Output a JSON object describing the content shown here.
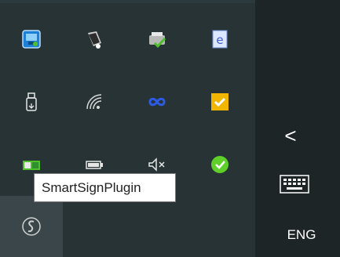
{
  "tooltip": {
    "text": "SmartSignPlugin"
  },
  "taskbar": {
    "language": "ENG",
    "chevron": "<"
  },
  "tray_icons": [
    {
      "name": "network-config-icon"
    },
    {
      "name": "speaker-app-icon"
    },
    {
      "name": "printer-check-icon"
    },
    {
      "name": "e-app-icon"
    },
    {
      "name": "usb-drive-icon"
    },
    {
      "name": "wifi-icon"
    },
    {
      "name": "infinity-link-icon"
    },
    {
      "name": "security-check-icon"
    },
    {
      "name": "battery-plug-icon"
    },
    {
      "name": "battery-icon"
    },
    {
      "name": "volume-icon"
    },
    {
      "name": "green-shield-icon"
    },
    {
      "name": "smartsign-plugin-icon"
    }
  ],
  "colors": {
    "flyout_bg": "#283335",
    "taskbar_bg": "#1e2527",
    "active_cell": "#3a4649",
    "accent_blue": "#1e7fd6",
    "accent_green": "#4cbf2a",
    "accent_yellow": "#f2b600"
  }
}
